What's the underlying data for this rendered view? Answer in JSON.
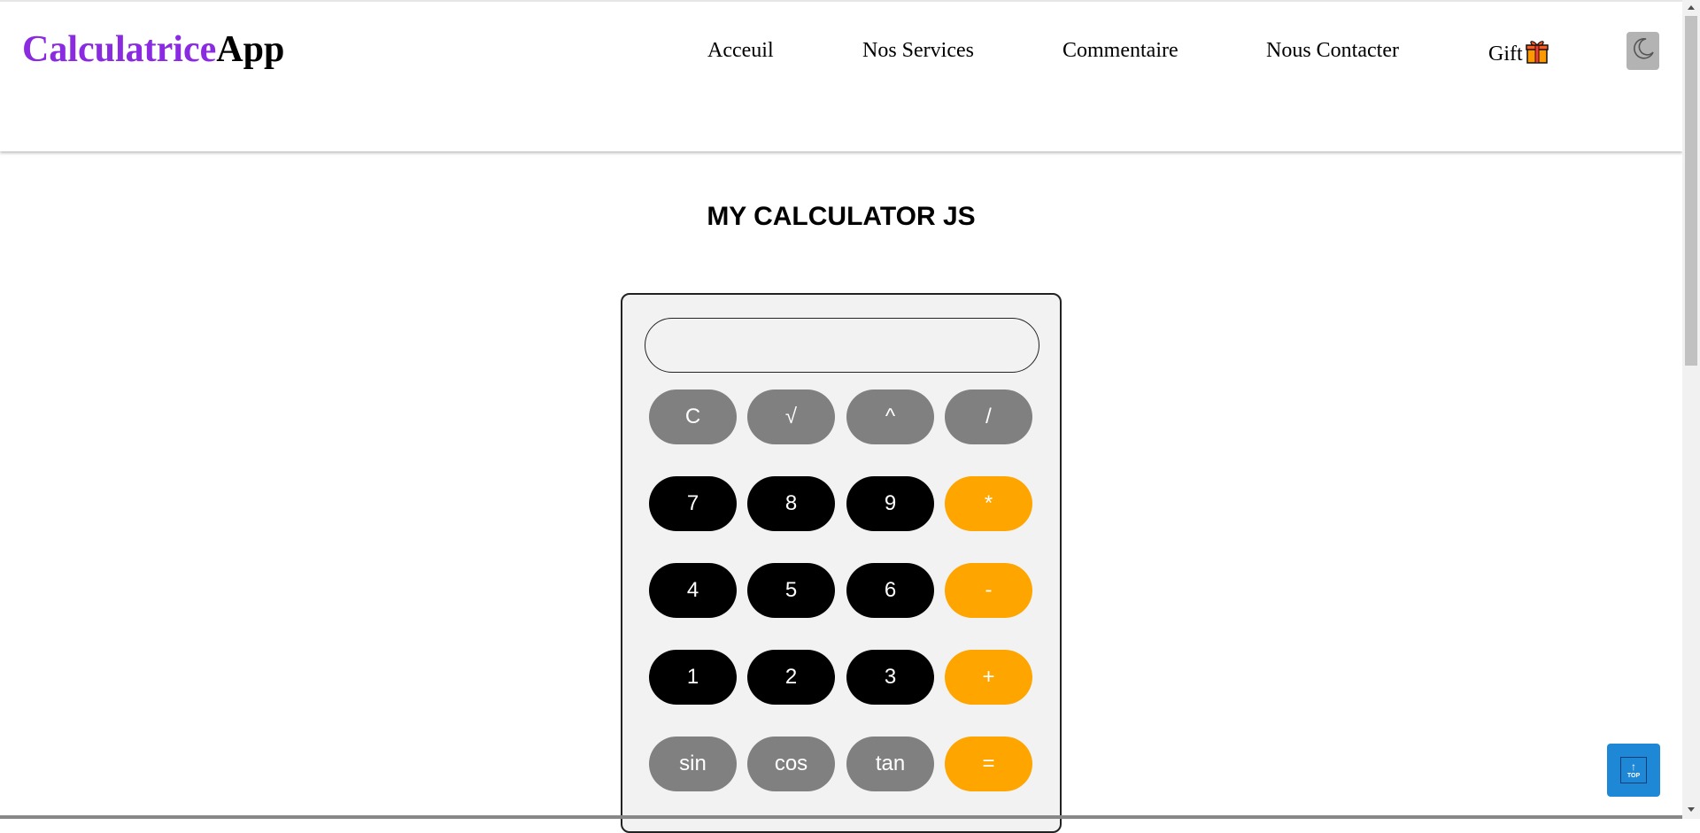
{
  "header": {
    "logo_part1": "Calculatrice",
    "logo_part2": "App",
    "nav": [
      "Acceuil",
      "Nos Services",
      "Commentaire",
      "Nous Contacter",
      "Gift"
    ],
    "theme_icon": "moon-icon"
  },
  "main": {
    "title": "MY CALCULATOR JS"
  },
  "calculator": {
    "display_value": "",
    "keys": [
      "C",
      "√",
      "^",
      "/",
      "7",
      "8",
      "9",
      "*",
      "4",
      "5",
      "6",
      "-",
      "1",
      "2",
      "3",
      "+",
      "sin",
      "cos",
      "tan",
      "="
    ]
  },
  "scroll_top": {
    "label": "TOP",
    "icon": "arrow-up-icon"
  },
  "colors": {
    "logo_accent": "#8a2be2",
    "key_gray": "#808080",
    "key_black": "#000000",
    "key_orange": "#ffa500",
    "top_button": "#1e88d6"
  }
}
